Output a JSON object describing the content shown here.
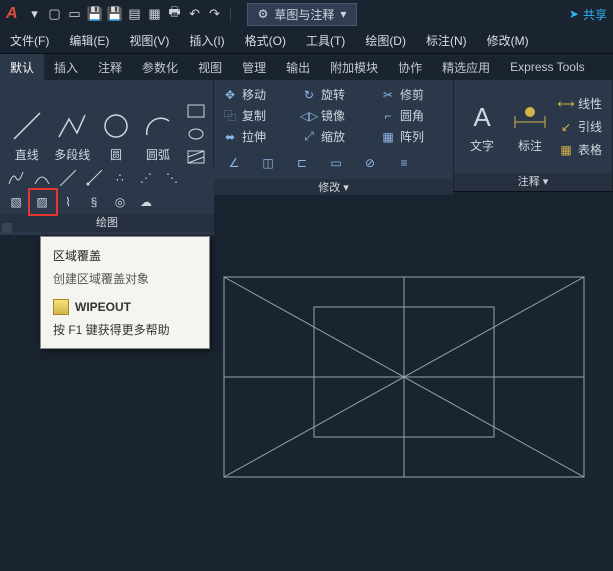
{
  "qat": {
    "workspace_label": "草图与注释",
    "share_label": "共享"
  },
  "menus": {
    "file": "文件(F)",
    "edit": "编辑(E)",
    "view": "视图(V)",
    "insert": "插入(I)",
    "format": "格式(O)",
    "tools": "工具(T)",
    "draw": "绘图(D)",
    "dimension": "标注(N)",
    "modify": "修改(M)"
  },
  "tabs": {
    "default": "默认",
    "insert": "插入",
    "annotate": "注释",
    "parametric": "参数化",
    "view": "视图",
    "manage": "管理",
    "output": "输出",
    "addins": "附加模块",
    "collaborate": "协作",
    "featured": "精选应用",
    "express": "Express Tools"
  },
  "draw_panel": {
    "title": "绘图",
    "line": "直线",
    "polyline": "多段线",
    "circle": "圆",
    "arc": "圆弧"
  },
  "modify_panel": {
    "title": "修改 ▾",
    "move": "移动",
    "rotate": "旋转",
    "trim": "修剪",
    "copy": "复制",
    "mirror": "镜像",
    "fillet": "圆角",
    "stretch": "拉伸",
    "scale": "缩放",
    "array": "阵列"
  },
  "annot_panel": {
    "title": "注释 ▾",
    "text": "文字",
    "dimension": "标注",
    "linear": "线性",
    "leader": "引线",
    "table": "表格"
  },
  "tooltip": {
    "title": "区域覆盖",
    "desc": "创建区域覆盖对象",
    "command": "WIPEOUT",
    "help": "按 F1 键获得更多帮助"
  }
}
